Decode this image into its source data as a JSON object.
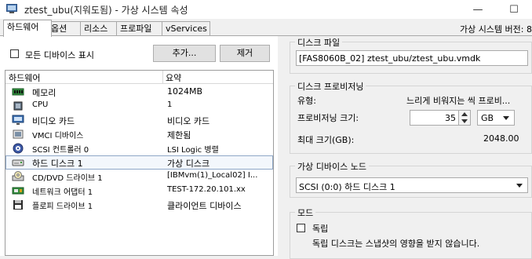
{
  "window": {
    "title": "ztest_ubu(지워도됨) - 가상 시스템 속성",
    "minimize_glyph": "—",
    "maximize_glyph": "☐"
  },
  "tabs": [
    {
      "label": "하드웨어",
      "active": true
    },
    {
      "label": "옵션",
      "active": false
    },
    {
      "label": "리소스",
      "active": false
    },
    {
      "label": "프로파일",
      "active": false
    },
    {
      "label": "vServices",
      "active": false
    }
  ],
  "version_label": "가상 시스템 버전: 8",
  "hardware_panel": {
    "show_all_devices_label": "모든 디바이스 표시",
    "show_all_devices_checked": false,
    "add_button": "추가...",
    "remove_button": "제거",
    "columns": [
      "하드웨어",
      "요약"
    ],
    "rows": [
      {
        "name": "메모리",
        "summary": "1024MB",
        "icon": "memory-icon",
        "selected": false
      },
      {
        "name": "CPU",
        "summary": "1",
        "icon": "cpu-icon",
        "selected": false
      },
      {
        "name": "비디오 카드",
        "summary": "비디오 카드",
        "icon": "video-card-icon",
        "selected": false
      },
      {
        "name": "VMCI 디바이스",
        "summary": "제한됨",
        "icon": "vmci-device-icon",
        "selected": false
      },
      {
        "name": "SCSI 컨트롤러 0",
        "summary": "LSI Logic 병렬",
        "icon": "scsi-controller-icon",
        "selected": false
      },
      {
        "name": "하드 디스크 1",
        "summary": "가상 디스크",
        "icon": "hard-disk-icon",
        "selected": true
      },
      {
        "name": "CD/DVD 드라이브 1",
        "summary": "[IBMvm(1)_Local02] I...",
        "icon": "cd-dvd-drive-icon",
        "selected": false
      },
      {
        "name": "네트워크 어댑터 1",
        "summary": "TEST-172.20.101.xx",
        "icon": "network-adapter-icon",
        "selected": false
      },
      {
        "name": "플로피 드라이브 1",
        "summary": "클라이언트 디바이스",
        "icon": "floppy-drive-icon",
        "selected": false
      }
    ]
  },
  "disk_file": {
    "group_title": "디스크 파일",
    "value": "[FAS8060B_02] ztest_ubu/ztest_ubu.vmdk"
  },
  "provisioning": {
    "group_title": "디스크 프로비저닝",
    "type_label": "유형:",
    "type_value": "느리게 비워지는 씩 프로비...",
    "size_label": "프로비저닝 크기:",
    "size_value": "35",
    "size_unit": "GB",
    "max_size_label": "최대 크기(GB):",
    "max_size_value": "2048.00"
  },
  "virtual_device_node": {
    "group_title": "가상 디바이스 노드",
    "selected": "SCSI (0:0) 하드 디스크 1"
  },
  "mode": {
    "group_title": "모드",
    "independent_label": "독립",
    "independent_checked": false,
    "independent_desc": "독립 디스크는 스냅샷의 영향을 받지 않습니다."
  }
}
